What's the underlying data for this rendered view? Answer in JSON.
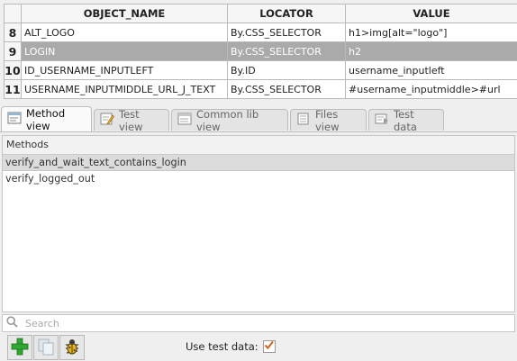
{
  "table": {
    "headers": [
      "OBJECT_NAME",
      "LOCATOR",
      "VALUE"
    ],
    "rows": [
      {
        "num": "8",
        "name": "ALT_LOGO",
        "locator": "By.CSS_SELECTOR",
        "value": "h1>img[alt=\"logo\"]"
      },
      {
        "num": "9",
        "name": "LOGIN",
        "locator": "By.CSS_SELECTOR",
        "value": "h2"
      },
      {
        "num": "10",
        "name": "ID_USERNAME_INPUTLEFT",
        "locator": "By.ID",
        "value": "username_inputleft"
      },
      {
        "num": "11",
        "name": "USERNAME_INPUTMIDDLE_URL_J_TEXT",
        "locator": "By.CSS_SELECTOR",
        "value": "#username_inputmiddle>#url"
      }
    ]
  },
  "tabs": [
    {
      "label": "Method view",
      "icon": "method-view-icon"
    },
    {
      "label": "Test view",
      "icon": "test-view-icon"
    },
    {
      "label": "Common lib view",
      "icon": "common-lib-icon"
    },
    {
      "label": "Files view",
      "icon": "files-view-icon"
    },
    {
      "label": "Test data",
      "icon": "test-data-icon"
    }
  ],
  "methods": {
    "header": "Methods",
    "items": [
      "verify_and_wait_text_contains_login",
      "verify_logged_out"
    ]
  },
  "search": {
    "placeholder": "Search",
    "value": ""
  },
  "toolbar": {
    "use_test_data_label": "Use test data:",
    "use_test_data_checked": true
  },
  "colors": {
    "selected_row": "#aaaaaa",
    "add_green": "#2fa82f",
    "checkbox_check": "#d0601c"
  }
}
